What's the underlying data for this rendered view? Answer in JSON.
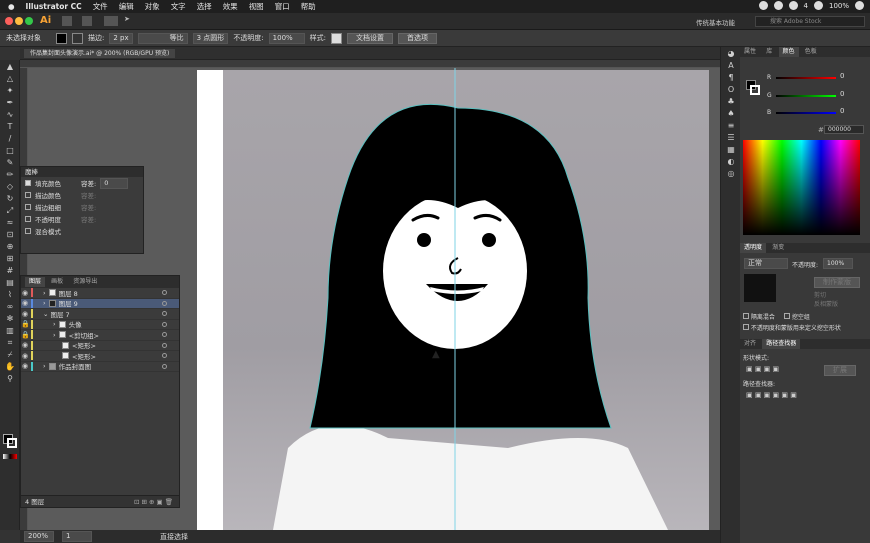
{
  "menubar": {
    "app": "Illustrator CC",
    "items": [
      "文件",
      "编辑",
      "对象",
      "文字",
      "选择",
      "效果",
      "视图",
      "窗口",
      "帮助"
    ],
    "battery": "100%",
    "time": "4"
  },
  "appbar": {
    "workspace": "传统基本功能",
    "search_placeholder": "搜索 Adobe Stock"
  },
  "control": {
    "no_selection": "未选择对象",
    "stroke_label": "描边:",
    "stroke_value": "2 px",
    "stroke_style": "等比",
    "brush": "3 点圆形",
    "opacity_label": "不透明度:",
    "opacity_value": "100%",
    "style_label": "样式:",
    "doc_setup": "文档设置",
    "prefs": "首选项"
  },
  "tab": {
    "title": "作品集封面头像演示.ai* @ 200% (RGB/GPU 预览)"
  },
  "magic_panel": {
    "title": "魔棒",
    "rows": [
      {
        "label": "填充颜色",
        "checked": true,
        "tol_label": "容差:",
        "tol": "0"
      },
      {
        "label": "描边颜色",
        "checked": false,
        "tol_label": "容差:",
        "tol": ""
      },
      {
        "label": "描边粗细",
        "checked": false,
        "tol_label": "容差:",
        "tol": ""
      },
      {
        "label": "不透明度",
        "checked": false,
        "tol_label": "容差:",
        "tol": ""
      },
      {
        "label": "混合模式",
        "checked": false,
        "tol_label": "",
        "tol": ""
      }
    ]
  },
  "layers_panel": {
    "tabs": [
      "图层",
      "画板",
      "资源导出"
    ],
    "rows": [
      {
        "name": "图层 8",
        "indent": 0,
        "color": "#e05a5a"
      },
      {
        "name": "图层 9",
        "indent": 0,
        "color": "#5a8ae0",
        "selected": true
      },
      {
        "name": "图层 7",
        "indent": 0,
        "color": "#e0d35a"
      },
      {
        "name": "头像",
        "indent": 1,
        "color": "#e0d35a"
      },
      {
        "name": "<剪切组>",
        "indent": 1,
        "color": "#e0d35a"
      },
      {
        "name": "<矩形>",
        "indent": 1,
        "color": "#e0d35a"
      },
      {
        "name": "<矩形>",
        "indent": 1,
        "color": "#e0d35a"
      },
      {
        "name": "作品封面图",
        "indent": 0,
        "color": "#4ac9c9"
      }
    ],
    "footer": "4 图层"
  },
  "color_panel": {
    "tabs": [
      "属性",
      "库",
      "颜色",
      "色板"
    ],
    "r": "0",
    "g": "0",
    "b": "0",
    "hex": "000000"
  },
  "transparency": {
    "tabs": [
      "透明度",
      "渐变"
    ],
    "mode": "正常",
    "opacity_label": "不透明度:",
    "opacity": "100%",
    "make_mask": "制作蒙版",
    "clip": "剪切",
    "invert": "反相蒙版",
    "isolate": "隔离混合",
    "knockout": "挖空组",
    "opacity_mask": "不透明度和蒙版用来定义挖空形状"
  },
  "pathfinder": {
    "tabs": [
      "对齐",
      "路径查找器"
    ],
    "shape_modes": "形状模式:",
    "expand": "扩展",
    "pathfinders": "路径查找器:"
  },
  "status": {
    "zoom": "200%",
    "page": "1",
    "tool": "直接选择"
  }
}
